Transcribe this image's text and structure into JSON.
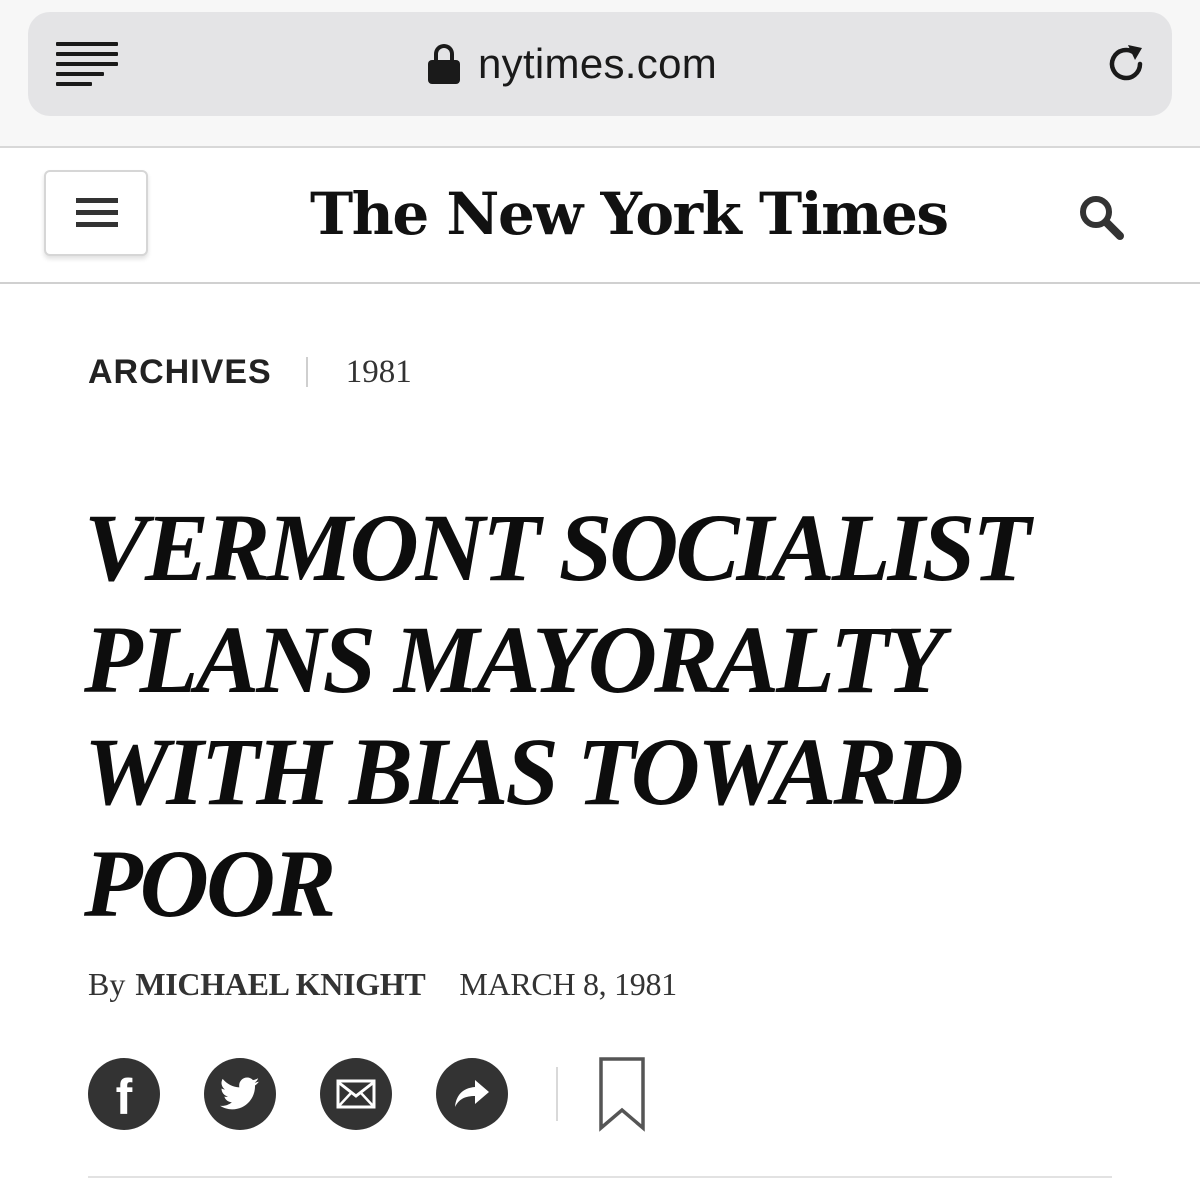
{
  "browser": {
    "url": "nytimes.com",
    "reader_icon": "reader-mode-icon",
    "lock_icon": "lock-icon",
    "reload_icon": "reload-icon"
  },
  "header": {
    "masthead": "The New York Times",
    "menu_icon": "hamburger-menu-icon",
    "search_icon": "search-icon"
  },
  "article": {
    "section": "ARCHIVES",
    "year": "1981",
    "headline": "VERMONT SOCIALIST PLANS MAYORALTY WITH BIAS TOWARD POOR",
    "byline_prefix": "By",
    "author": "MICHAEL KNIGHT",
    "date": "MARCH 8, 1981"
  },
  "share": {
    "buttons": [
      {
        "icon": "facebook-icon",
        "glyph": "f"
      },
      {
        "icon": "twitter-icon"
      },
      {
        "icon": "email-icon"
      },
      {
        "icon": "share-arrow-icon"
      }
    ],
    "save_icon": "bookmark-icon"
  }
}
